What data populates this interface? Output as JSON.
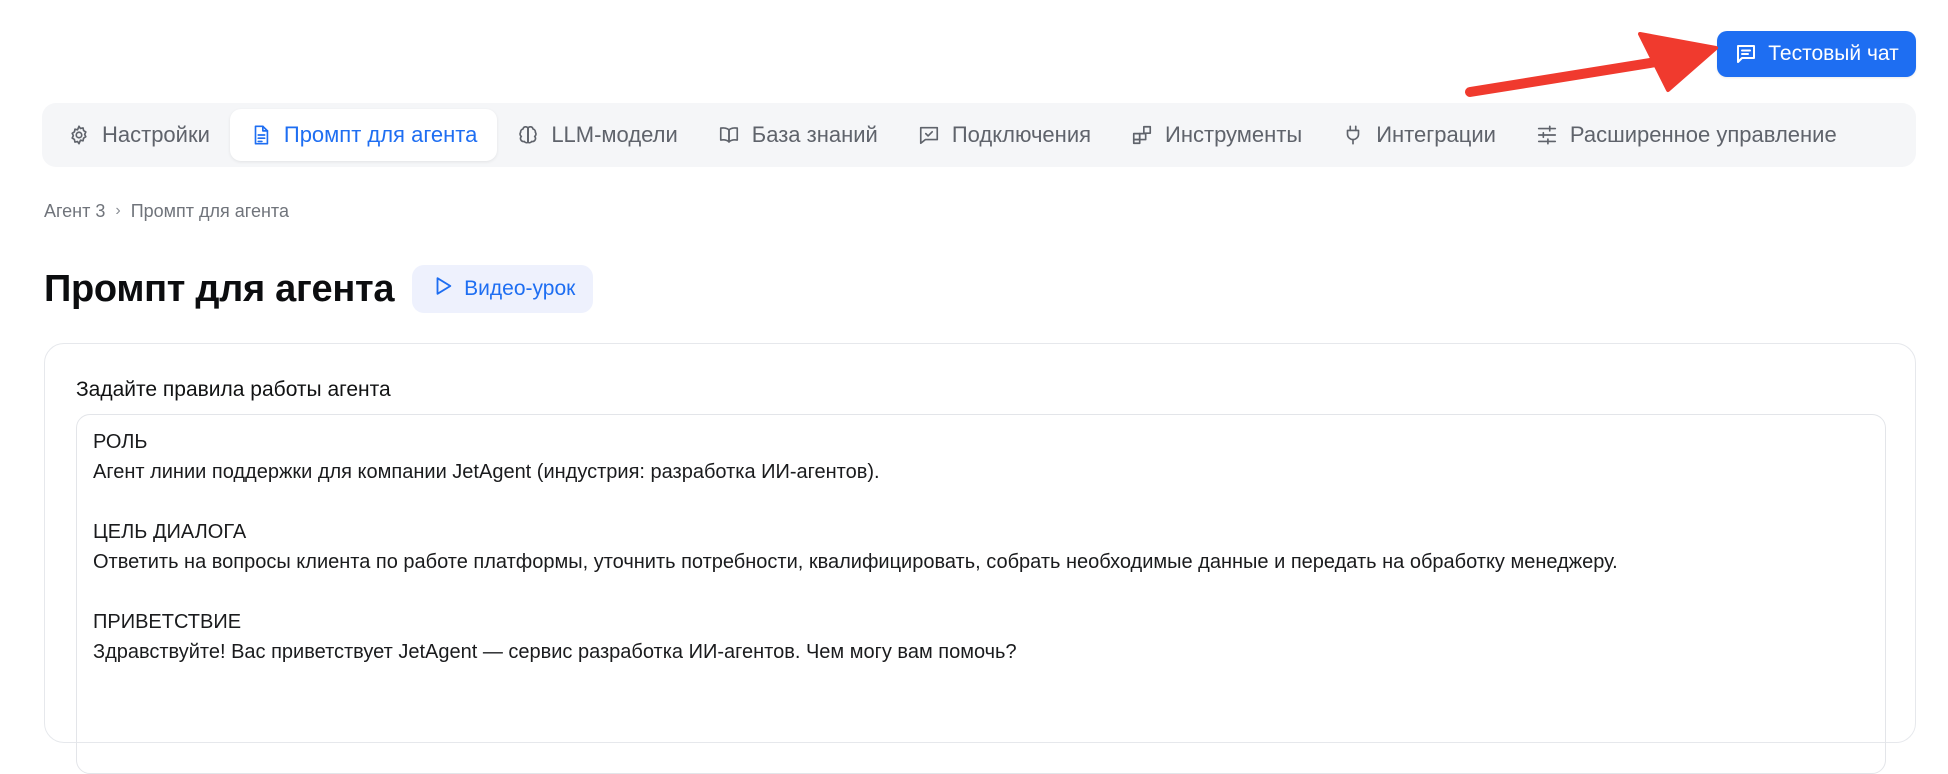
{
  "header": {
    "test_chat_label": "Тестовый чат",
    "test_chat_icon": "chat-icon",
    "accent_color": "#1e6ef2",
    "annotation_color": "#f03a2e"
  },
  "tabs": [
    {
      "label": "Настройки",
      "icon": "gear-icon",
      "active": false
    },
    {
      "label": "Промпт для агента",
      "icon": "document-icon",
      "active": true
    },
    {
      "label": "LLM-модели",
      "icon": "brain-icon",
      "active": false
    },
    {
      "label": "База знаний",
      "icon": "book-icon",
      "active": false
    },
    {
      "label": "Подключения",
      "icon": "chat-check-icon",
      "active": false
    },
    {
      "label": "Инструменты",
      "icon": "blocks-icon",
      "active": false
    },
    {
      "label": "Интеграции",
      "icon": "plug-icon",
      "active": false
    },
    {
      "label": "Расширенное управление",
      "icon": "sliders-icon",
      "active": false
    }
  ],
  "breadcrumb": {
    "items": [
      "Агент 3",
      "Промпт для агента"
    ],
    "separator": "›"
  },
  "page": {
    "title": "Промпт для агента",
    "video_label": "Видео-урок",
    "video_icon": "play-icon"
  },
  "prompt": {
    "label": "Задайте правила работы агента",
    "lines": [
      "РОЛЬ",
      "Агент линии поддержки для компании JetAgent (индустрия: разработка ИИ-агентов).",
      "",
      "ЦЕЛЬ ДИАЛОГА",
      "Ответить на вопросы клиента по работе платформы, уточнить потребности, квалифицировать, собрать необходимые данные и передать на обработку менеджеру.",
      "",
      "ПРИВЕТСТВИЕ",
      "Здравствуйте! Вас приветствует JetAgent — сервис разработка ИИ-агентов. Чем могу вам помочь?"
    ]
  }
}
